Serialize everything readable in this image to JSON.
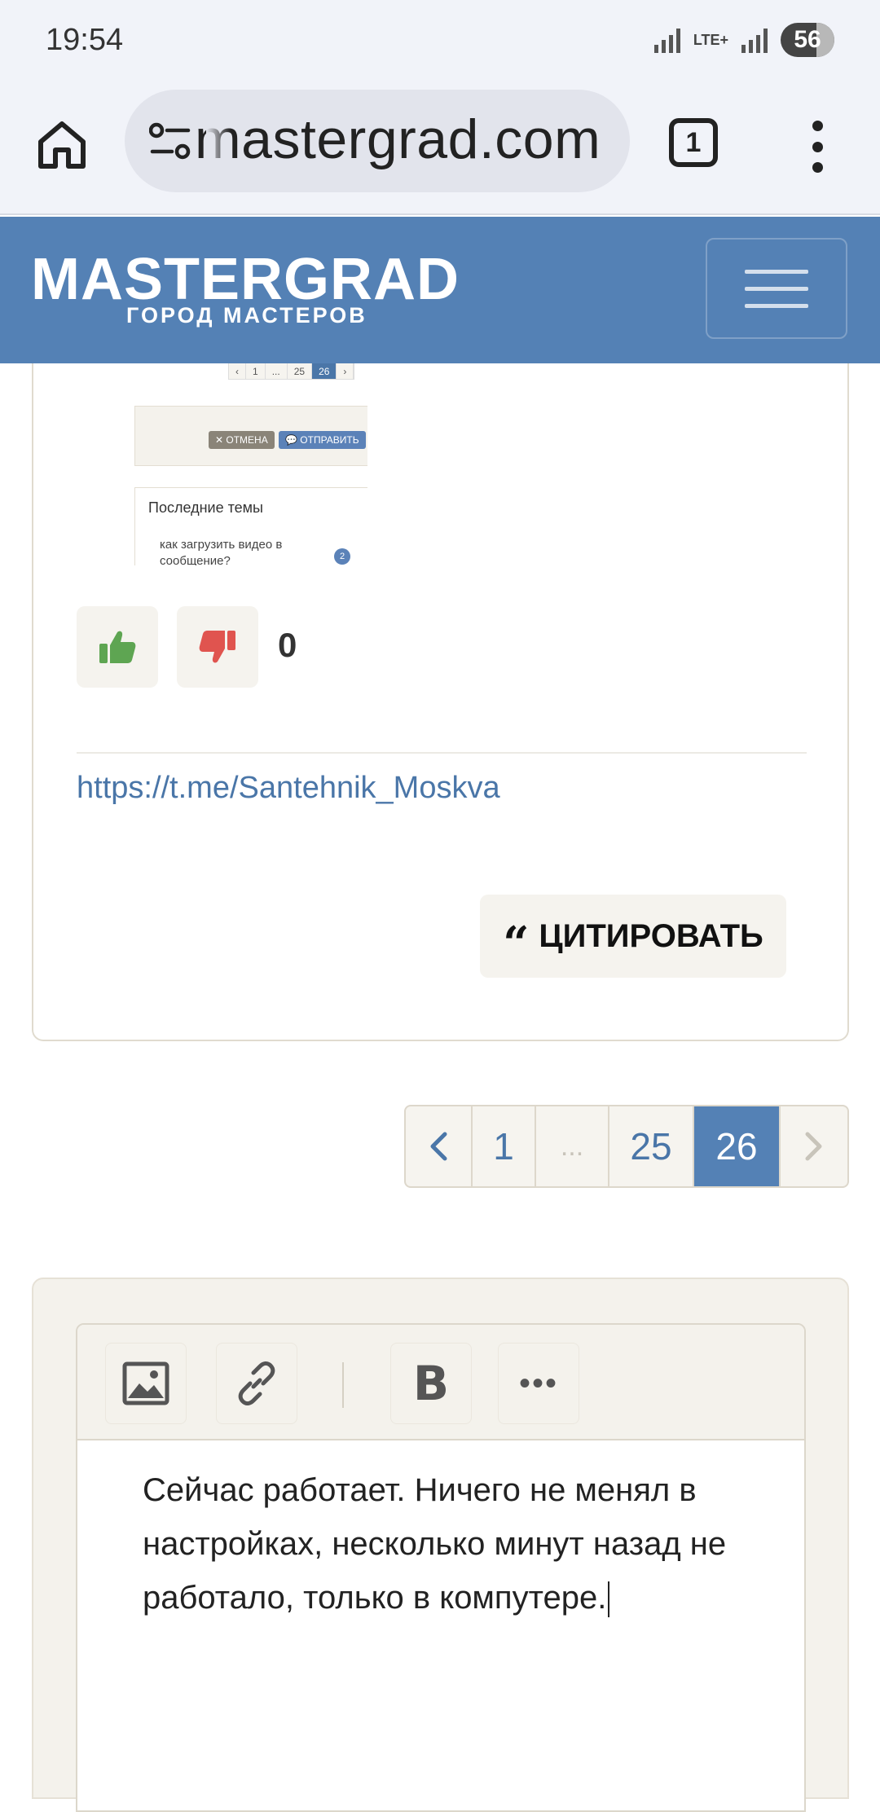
{
  "status_bar": {
    "time": "19:54",
    "network": "LTE+",
    "battery": "56"
  },
  "browser": {
    "url": "mastergrad.com",
    "tab_count": "1"
  },
  "site": {
    "logo": "MASTERGRAD",
    "tagline": "ГОРОД МАСТЕРОВ"
  },
  "embedded_screenshot": {
    "pager": [
      "‹",
      "1",
      "...",
      "25",
      "26",
      "›"
    ],
    "cancel_label": "✕ ОТМЕНА",
    "send_label": "💬 ОТПРАВИТЬ",
    "latest_title": "Последние темы",
    "latest_item": "как загрузить видео в сообщение?",
    "latest_badge": "2"
  },
  "post": {
    "vote_count": "0",
    "signature_link": "https://t.me/Santehnik_Moskva",
    "quote_label": "ЦИТИРОВАТЬ"
  },
  "pagination": {
    "prev": "‹",
    "pages": [
      "1",
      "...",
      "25",
      "26"
    ],
    "next": "›",
    "current": "26"
  },
  "editor": {
    "bold_label": "B",
    "more_label": "•••",
    "text": "Сейчас работает. Ничего не менял в настройках, несколько минут назад не работало, только в компутере."
  },
  "colors": {
    "brand": "#5481b5",
    "link": "#4a76a8",
    "like": "#5ea552",
    "dislike": "#e0544f"
  }
}
